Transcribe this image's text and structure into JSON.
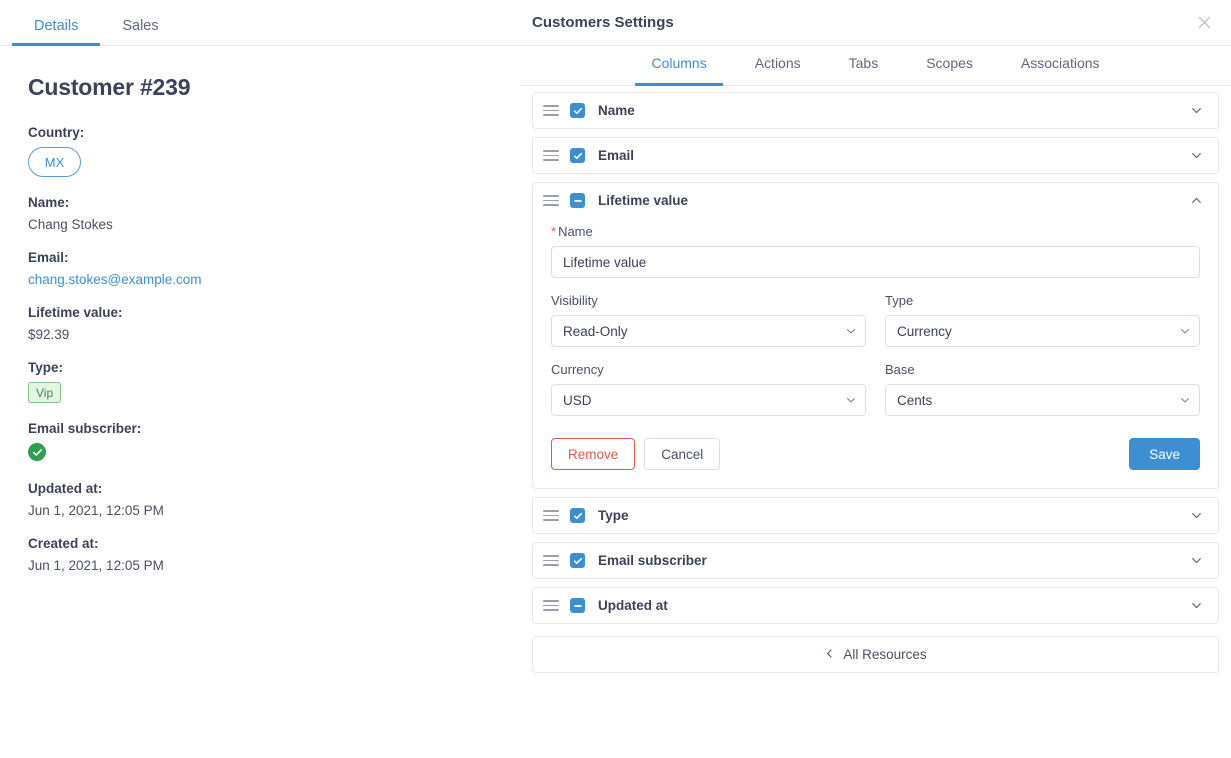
{
  "left": {
    "tabs": [
      {
        "label": "Details",
        "active": true
      },
      {
        "label": "Sales",
        "active": false
      }
    ],
    "title": "Customer #239",
    "fields": [
      {
        "label": "Country:",
        "value": "MX",
        "kind": "pill"
      },
      {
        "label": "Name:",
        "value": "Chang Stokes",
        "kind": "text"
      },
      {
        "label": "Email:",
        "value": "chang.stokes@example.com",
        "kind": "link"
      },
      {
        "label": "Lifetime value:",
        "value": "$92.39",
        "kind": "text"
      },
      {
        "label": "Type:",
        "value": "Vip",
        "kind": "badge"
      },
      {
        "label": "Email subscriber:",
        "value": "",
        "kind": "check"
      },
      {
        "label": "Updated at:",
        "value": "Jun 1, 2021, 12:05 PM",
        "kind": "text"
      },
      {
        "label": "Created at:",
        "value": "Jun 1, 2021, 12:05 PM",
        "kind": "text"
      }
    ]
  },
  "panel": {
    "title": "Customers Settings",
    "close_icon": "close-icon",
    "tabs": [
      {
        "label": "Columns",
        "active": true
      },
      {
        "label": "Actions",
        "active": false
      },
      {
        "label": "Tabs",
        "active": false
      },
      {
        "label": "Scopes",
        "active": false
      },
      {
        "label": "Associations",
        "active": false
      }
    ],
    "columns": [
      {
        "label": "Name",
        "checkbox": "checked",
        "expanded": false,
        "chevron": "chevron-down-icon"
      },
      {
        "label": "Email",
        "checkbox": "checked",
        "expanded": false,
        "chevron": "chevron-down-icon"
      },
      {
        "label": "Lifetime value",
        "checkbox": "indeterminate",
        "expanded": true,
        "chevron": "chevron-up-icon"
      },
      {
        "label": "Type",
        "checkbox": "checked",
        "expanded": false,
        "chevron": "chevron-down-icon"
      },
      {
        "label": "Email subscriber",
        "checkbox": "checked",
        "expanded": false,
        "chevron": "chevron-down-icon"
      },
      {
        "label": "Updated at",
        "checkbox": "indeterminate",
        "expanded": false,
        "chevron": "chevron-down-icon"
      }
    ],
    "form": {
      "name_label": "Name",
      "name_required": "*",
      "name_value": "Lifetime value",
      "visibility_label": "Visibility",
      "visibility_value": "Read-Only",
      "type_label": "Type",
      "type_value": "Currency",
      "currency_label": "Currency",
      "currency_value": "USD",
      "base_label": "Base",
      "base_value": "Cents",
      "remove_label": "Remove",
      "cancel_label": "Cancel",
      "save_label": "Save"
    },
    "footer": {
      "all_resources_label": "All Resources",
      "back_icon": "chevron-left-icon"
    }
  },
  "colors": {
    "accent": "#3d8fd1",
    "danger": "#e2584d",
    "success": "#2f9e4f",
    "text": "#3c4257"
  }
}
